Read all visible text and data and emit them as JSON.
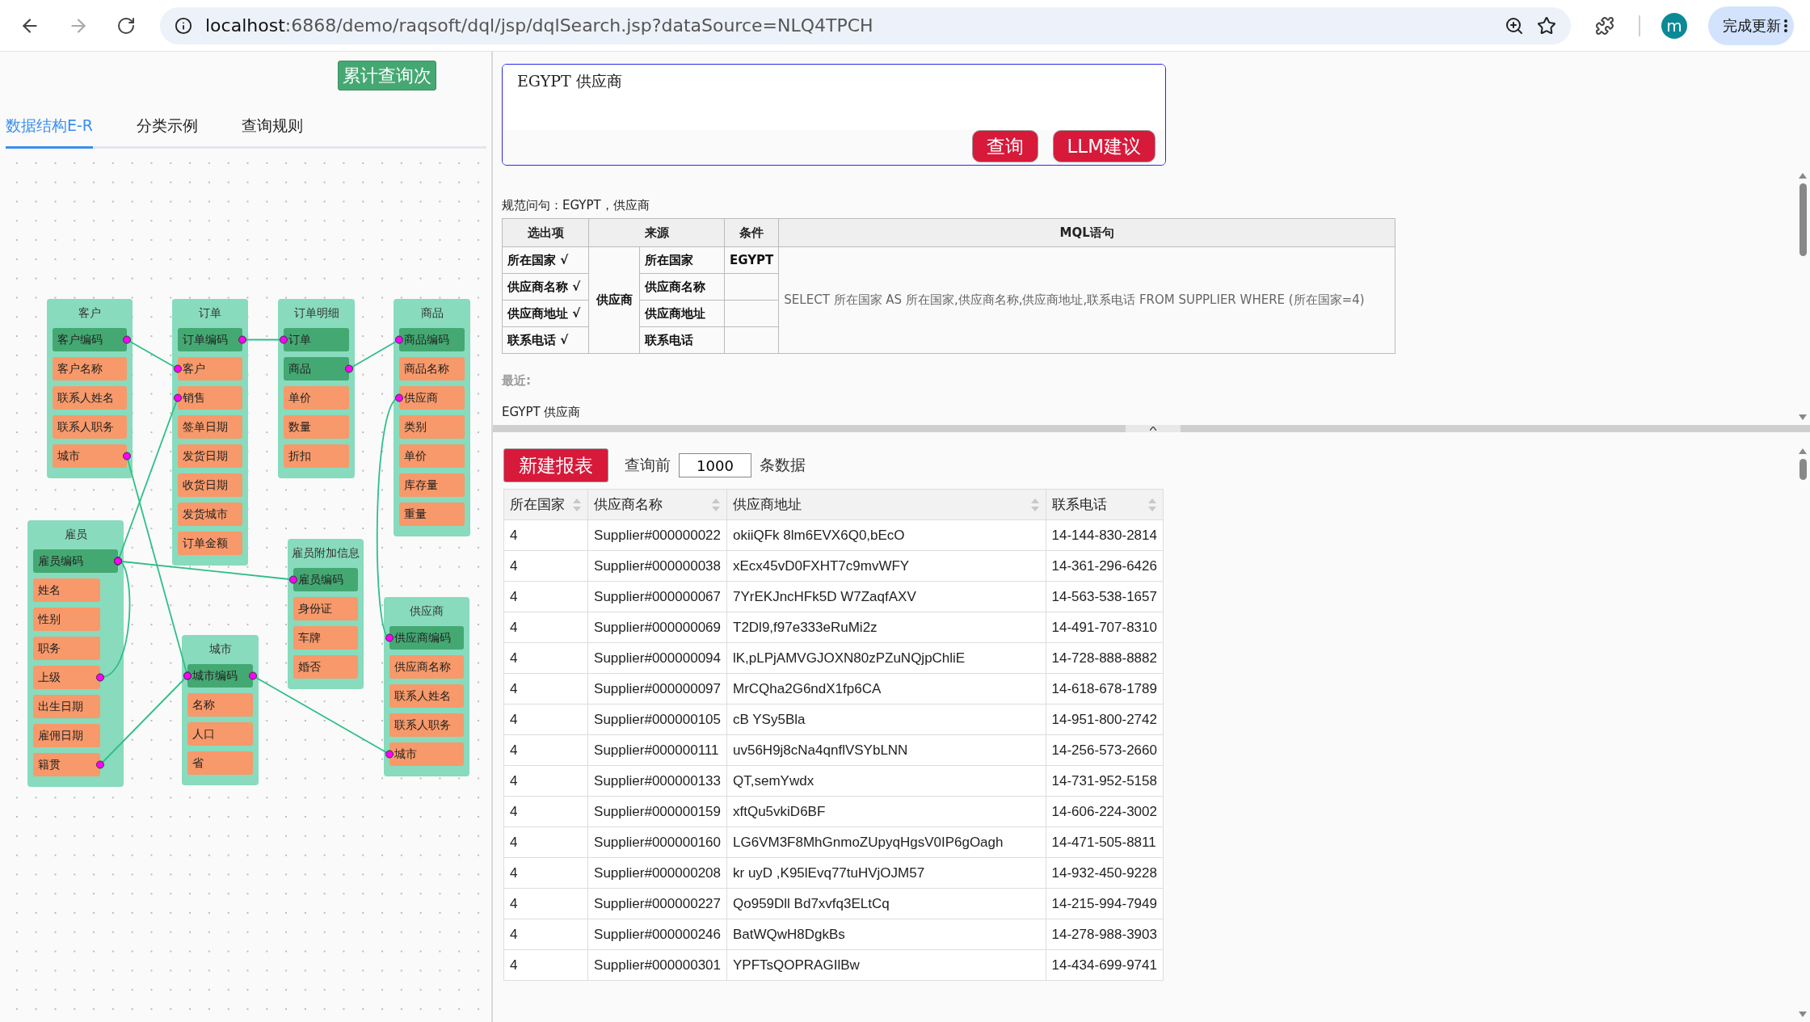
{
  "browser": {
    "url_host": "localhost",
    "url_rest": ":6868/demo/raqsoft/dql/jsp/dqlSearch.jsp?dataSource=NLQ4TPCH",
    "avatar": "m",
    "update_button": "完成更新"
  },
  "left_panel": {
    "counter_button": "累计查询次",
    "tabs": [
      {
        "label": "数据结构E-R",
        "selected": true
      },
      {
        "label": "分类示例",
        "selected": false
      },
      {
        "label": "查询规则",
        "selected": false
      }
    ],
    "er_diagram": {
      "entities": [
        {
          "name": "客户",
          "fields": [
            {
              "name": "客户编码",
              "kind": "key"
            },
            {
              "name": "客户名称",
              "kind": "attr"
            },
            {
              "name": "联系人姓名",
              "kind": "attr"
            },
            {
              "name": "联系人职务",
              "kind": "attr"
            },
            {
              "name": "城市",
              "kind": "attr"
            }
          ]
        },
        {
          "name": "订单",
          "fields": [
            {
              "name": "订单编码",
              "kind": "key"
            },
            {
              "name": "客户",
              "kind": "attr"
            },
            {
              "name": "销售",
              "kind": "attr"
            },
            {
              "name": "签单日期",
              "kind": "attr"
            },
            {
              "name": "发货日期",
              "kind": "attr"
            },
            {
              "name": "收货日期",
              "kind": "attr"
            },
            {
              "name": "发货城市",
              "kind": "attr"
            },
            {
              "name": "订单金额",
              "kind": "attr"
            }
          ]
        },
        {
          "name": "订单明细",
          "fields": [
            {
              "name": "订单",
              "kind": "key"
            },
            {
              "name": "商品",
              "kind": "key"
            },
            {
              "name": "单价",
              "kind": "attr"
            },
            {
              "name": "数量",
              "kind": "attr"
            },
            {
              "name": "折扣",
              "kind": "attr"
            }
          ]
        },
        {
          "name": "商品",
          "fields": [
            {
              "name": "商品编码",
              "kind": "key"
            },
            {
              "name": "商品名称",
              "kind": "attr"
            },
            {
              "name": "供应商",
              "kind": "attr"
            },
            {
              "name": "类别",
              "kind": "attr"
            },
            {
              "name": "单价",
              "kind": "attr"
            },
            {
              "name": "库存量",
              "kind": "attr"
            },
            {
              "name": "重量",
              "kind": "attr"
            }
          ]
        },
        {
          "name": "雇员",
          "fields": [
            {
              "name": "雇员编码",
              "kind": "key"
            },
            {
              "name": "姓名",
              "kind": "attr"
            },
            {
              "name": "性别",
              "kind": "attr"
            },
            {
              "name": "职务",
              "kind": "attr"
            },
            {
              "name": "上级",
              "kind": "attr"
            },
            {
              "name": "出生日期",
              "kind": "attr"
            },
            {
              "name": "雇佣日期",
              "kind": "attr"
            },
            {
              "name": "籍贯",
              "kind": "attr"
            }
          ]
        },
        {
          "name": "雇员附加信息",
          "fields": [
            {
              "name": "雇员编码",
              "kind": "key"
            },
            {
              "name": "身份证",
              "kind": "attr"
            },
            {
              "name": "车牌",
              "kind": "attr"
            },
            {
              "name": "婚否",
              "kind": "attr"
            }
          ]
        },
        {
          "name": "城市",
          "fields": [
            {
              "name": "城市编码",
              "kind": "key"
            },
            {
              "name": "名称",
              "kind": "attr"
            },
            {
              "name": "人口",
              "kind": "attr"
            },
            {
              "name": "省",
              "kind": "attr"
            }
          ]
        },
        {
          "name": "供应商",
          "fields": [
            {
              "name": "供应商编码",
              "kind": "key"
            },
            {
              "name": "供应商名称",
              "kind": "attr"
            },
            {
              "name": "联系人姓名",
              "kind": "attr"
            },
            {
              "name": "联系人职务",
              "kind": "attr"
            },
            {
              "name": "城市",
              "kind": "attr"
            }
          ]
        }
      ]
    }
  },
  "query": {
    "value": "EGYPT 供应商",
    "buttons": [
      "查询",
      "LLM建议"
    ]
  },
  "normalized_question": "规范问句：EGYPT，供应商",
  "parse_table": {
    "columns": [
      "选出项",
      "来源",
      "条件",
      "MQL语句"
    ],
    "source": "供应商",
    "rows": [
      {
        "item": "所在国家 √",
        "field": "所在国家",
        "condition": "EGYPT"
      },
      {
        "item": "供应商名称 √",
        "field": "供应商名称"
      },
      {
        "item": "供应商地址 √",
        "field": "供应商地址"
      },
      {
        "item": "联系电话 √",
        "field": "联系电话"
      }
    ],
    "mql": "SELECT 所在国家 AS 所在国家,供应商名称,供应商地址,联系电话 FROM SUPPLIER WHERE (所在国家=4)"
  },
  "recent": {
    "label": "最近:",
    "items": [
      "EGYPT 供应商"
    ]
  },
  "report": {
    "new_button": "新建报表",
    "limit_prefix": "查询前",
    "limit_value": "1000",
    "limit_suffix": "条数据",
    "columns": [
      "所在国家",
      "供应商名称",
      "供应商地址",
      "联系电话"
    ],
    "rows": [
      [
        "4",
        "Supplier#000000022",
        "okiiQFk 8lm6EVX6Q0,bEcO",
        "14-144-830-2814"
      ],
      [
        "4",
        "Supplier#000000038",
        "xEcx45vD0FXHT7c9mvWFY",
        "14-361-296-6426"
      ],
      [
        "4",
        "Supplier#000000067",
        "7YrEKJncHFk5D W7ZaqfAXV",
        "14-563-538-1657"
      ],
      [
        "4",
        "Supplier#000000069",
        "T2Dl9,f97e333eRuMi2z",
        "14-491-707-8310"
      ],
      [
        "4",
        "Supplier#000000094",
        "lK,pLPjAMVGJOXN80zPZuNQjpChliE",
        "14-728-888-8882"
      ],
      [
        "4",
        "Supplier#000000097",
        "MrCQha2G6ndX1fp6CA",
        "14-618-678-1789"
      ],
      [
        "4",
        "Supplier#000000105",
        "cB YSy5Bla",
        "14-951-800-2742"
      ],
      [
        "4",
        "Supplier#000000111",
        "uv56H9j8cNa4qnflVSYbLNN",
        "14-256-573-2660"
      ],
      [
        "4",
        "Supplier#000000133",
        "QT,semYwdx",
        "14-731-952-5158"
      ],
      [
        "4",
        "Supplier#000000159",
        "xftQu5vkiD6BF",
        "14-606-224-3002"
      ],
      [
        "4",
        "Supplier#000000160",
        "LG6VM3F8MhGnmoZUpyqHgsV0IP6gOagh",
        "14-471-505-8811"
      ],
      [
        "4",
        "Supplier#000000208",
        "kr uyD ,K95lEvq77tuHVjOJM57",
        "14-932-450-9228"
      ],
      [
        "4",
        "Supplier#000000227",
        "Qo959Dll Bd7xvfq3ELtCq",
        "14-215-994-7949"
      ],
      [
        "4",
        "Supplier#000000246",
        "BatWQwH8DgkBs",
        "14-278-988-3903"
      ],
      [
        "4",
        "Supplier#000000301",
        "YPFTsQOPRAGIlBw",
        "14-434-699-9741"
      ]
    ]
  }
}
